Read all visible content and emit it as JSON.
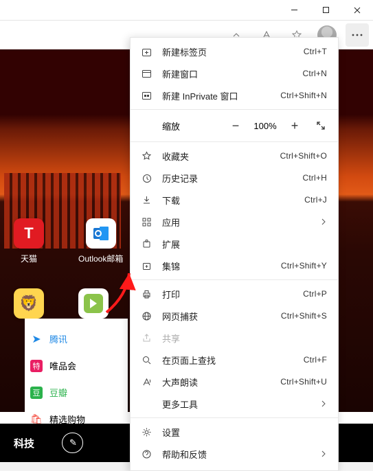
{
  "window": {
    "minimize": "min",
    "maximize": "max",
    "close": "close"
  },
  "toolbar": {
    "more": "..."
  },
  "tiles": [
    {
      "id": "tmall",
      "label": "天猫",
      "glyph": "T"
    },
    {
      "id": "outlook",
      "label": "Outlook邮箱",
      "glyph": "📧"
    }
  ],
  "tiles2": [
    {
      "id": "lion",
      "label": "",
      "glyph": "🦁"
    },
    {
      "id": "iqiyi",
      "label": "",
      "glyph": ""
    }
  ],
  "links": [
    {
      "badge": "➤",
      "label": "腾讯",
      "cls": "b-tx",
      "lk": "lk-blue"
    },
    {
      "badge": "特",
      "label": "唯品会",
      "cls": "b-vip",
      "lk": ""
    },
    {
      "badge": "豆",
      "label": "豆瓣",
      "cls": "b-db",
      "lk": "lk-green"
    },
    {
      "badge": "🛍",
      "label": "精选购物",
      "cls": "b-shop",
      "lk": ""
    }
  ],
  "bottom": {
    "category": "科技",
    "edit_glyph": "✎"
  },
  "menu": {
    "new_tab": "新建标签页",
    "new_tab_sc": "Ctrl+T",
    "new_window": "新建窗口",
    "new_window_sc": "Ctrl+N",
    "new_inprivate": "新建 InPrivate 窗口",
    "new_inprivate_sc": "Ctrl+Shift+N",
    "zoom_label": "缩放",
    "zoom_value": "100%",
    "favorites": "收藏夹",
    "favorites_sc": "Ctrl+Shift+O",
    "history": "历史记录",
    "history_sc": "Ctrl+H",
    "downloads": "下载",
    "downloads_sc": "Ctrl+J",
    "apps": "应用",
    "extensions": "扩展",
    "collections": "集锦",
    "collections_sc": "Ctrl+Shift+Y",
    "print": "打印",
    "print_sc": "Ctrl+P",
    "web_capture": "网页捕获",
    "web_capture_sc": "Ctrl+Shift+S",
    "share": "共享",
    "find": "在页面上查找",
    "find_sc": "Ctrl+F",
    "read_aloud": "大声朗读",
    "read_aloud_sc": "Ctrl+Shift+U",
    "more_tools": "更多工具",
    "settings": "设置",
    "help": "帮助和反馈"
  }
}
